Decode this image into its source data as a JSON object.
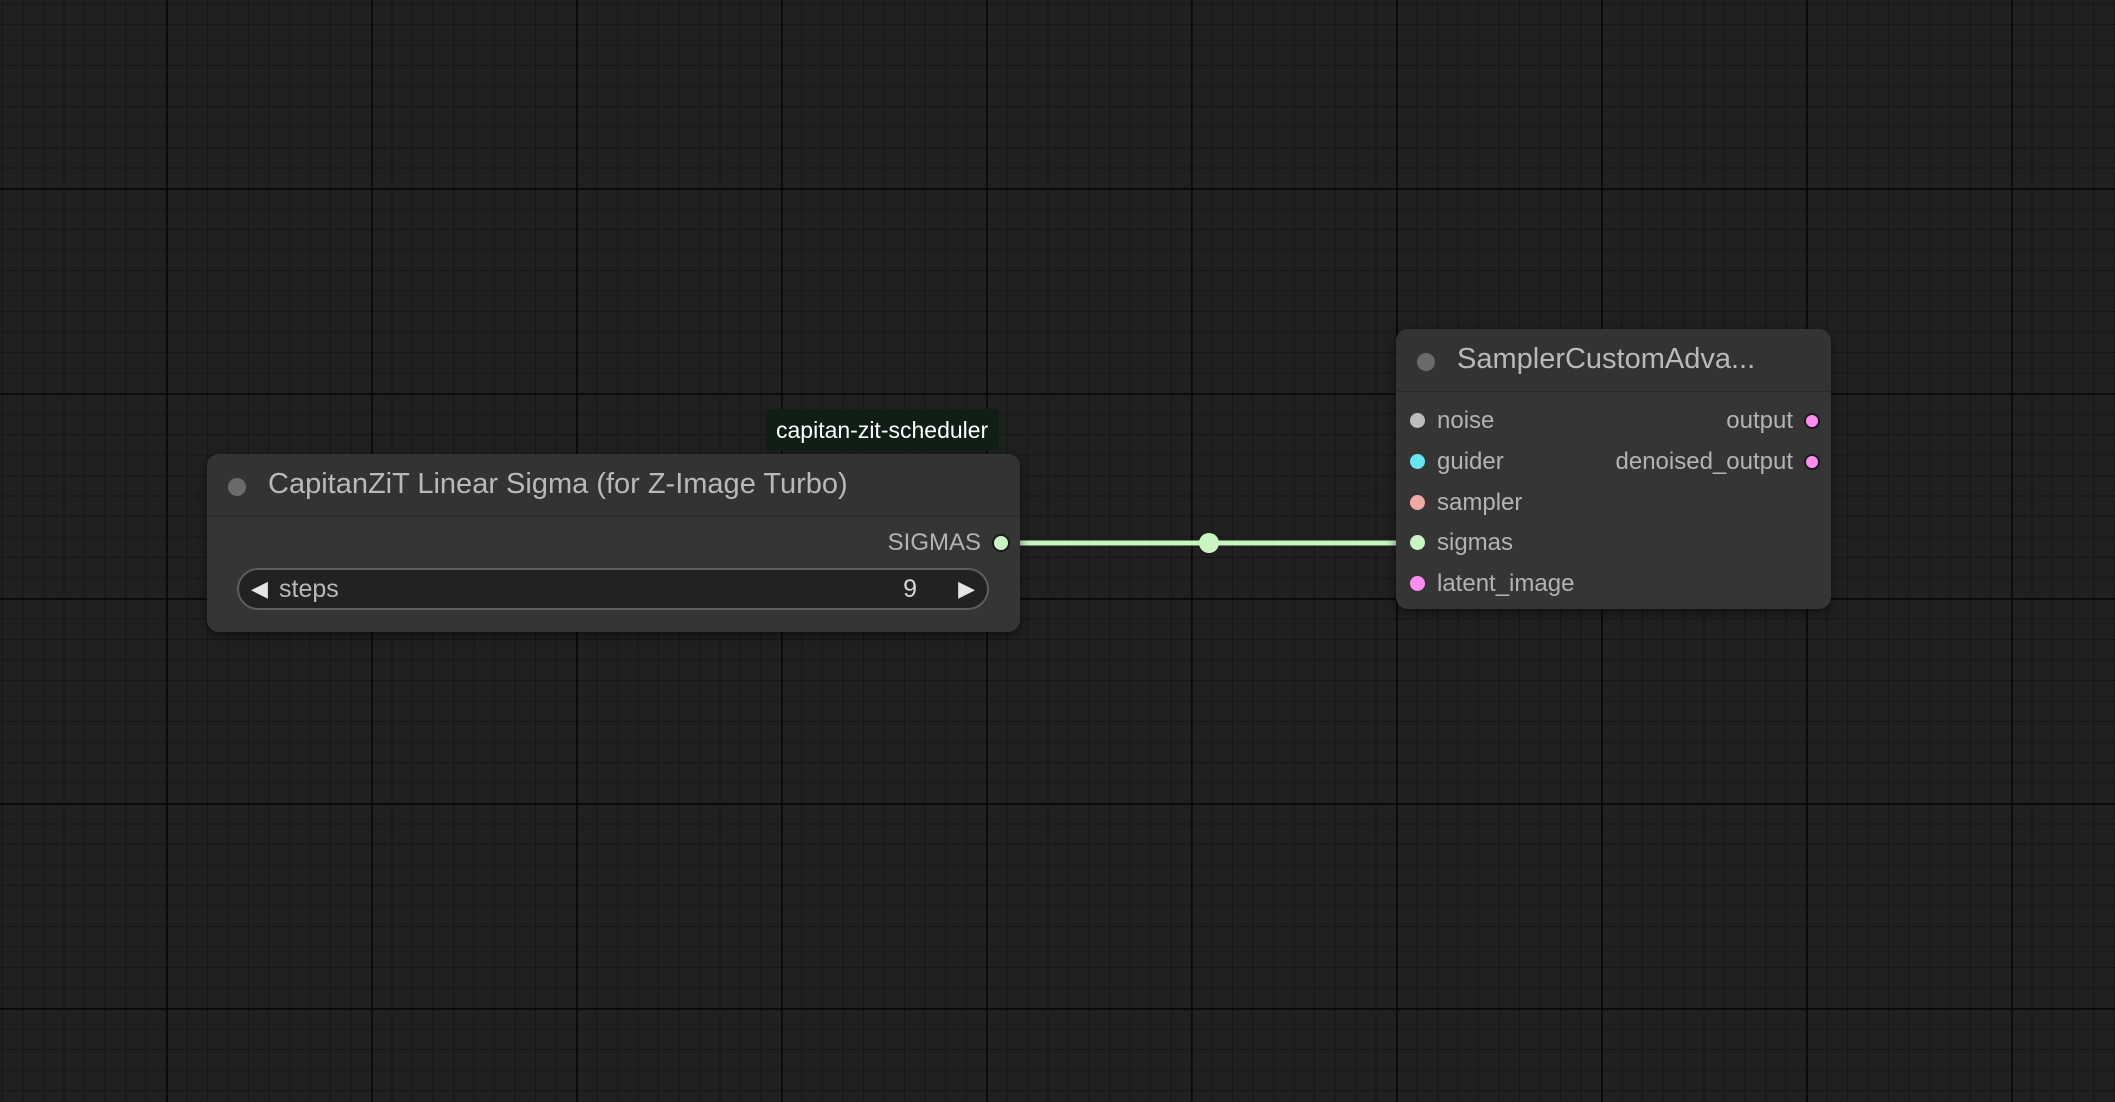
{
  "colors": {
    "sigmas": "#c8f5c2",
    "noise": "#bdbdbd",
    "guider": "#66e6ee",
    "sampler": "#f0a8a2",
    "latent": "#ff8cf0",
    "output": "#ff8cf0"
  },
  "tooltip": {
    "text": "capitan-zit-scheduler"
  },
  "node_linear_sigma": {
    "title": "CapitanZiT Linear Sigma (for Z-Image Turbo)",
    "outputs": [
      {
        "label": "SIGMAS",
        "type": "sigmas"
      }
    ],
    "widget": {
      "label": "steps",
      "value": "9",
      "decrement_icon": "triangle-left-icon",
      "increment_icon": "triangle-right-icon"
    }
  },
  "node_sampler": {
    "title": "SamplerCustomAdva...",
    "inputs": [
      {
        "label": "noise",
        "type": "noise"
      },
      {
        "label": "guider",
        "type": "guider"
      },
      {
        "label": "sampler",
        "type": "sampler"
      },
      {
        "label": "sigmas",
        "type": "sigmas"
      },
      {
        "label": "latent_image",
        "type": "latent"
      }
    ],
    "outputs": [
      {
        "label": "output",
        "type": "output"
      },
      {
        "label": "denoised_output",
        "type": "output"
      }
    ]
  },
  "links": [
    {
      "from": "node_linear_sigma.SIGMAS",
      "to": "node_sampler.sigmas",
      "type": "sigmas"
    }
  ]
}
